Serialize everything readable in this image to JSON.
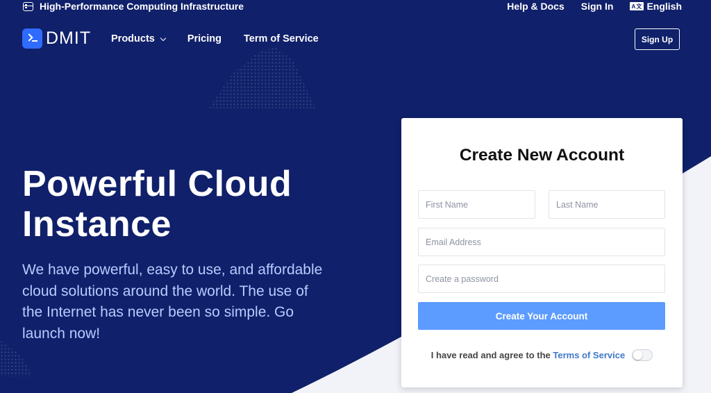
{
  "topbar": {
    "tagline": "High-Performance Computing Infrastructure",
    "links": [
      "Help & Docs",
      "Sign In"
    ],
    "language": "English",
    "language_icon_text": "A文"
  },
  "nav": {
    "logo_text": "DMIT",
    "items": [
      "Products",
      "Pricing",
      "Term of Service"
    ],
    "signup_label": "Sign Up"
  },
  "hero": {
    "title_line1": "Powerful Cloud",
    "title_line2": "Instance",
    "description": "We have powerful, easy to use, and affordable cloud solutions around the world. The use of the Internet has never been so simple. Go launch now!"
  },
  "form": {
    "title": "Create New Account",
    "first_name_placeholder": "First Name",
    "last_name_placeholder": "Last Name",
    "email_placeholder": "Email Address",
    "password_placeholder": "Create a password",
    "submit_label": "Create Your Account",
    "agree_text": "I have read and agree to the",
    "terms_link": "Terms of Service",
    "agree_toggle_on": false
  },
  "colors": {
    "background": "#10206a",
    "accent": "#2f6bff",
    "button": "#5c9bff",
    "link": "#3f78c9"
  }
}
